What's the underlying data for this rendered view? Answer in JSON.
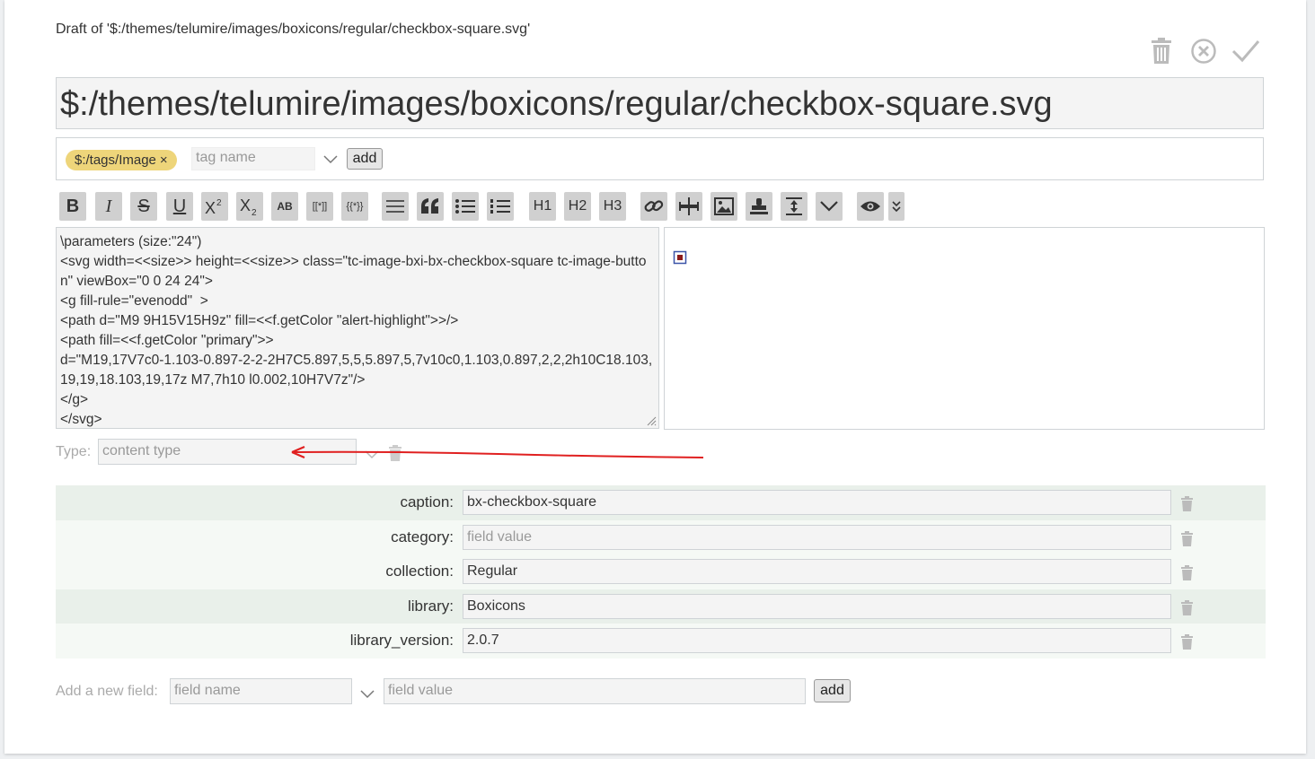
{
  "draft_title": "Draft of '$:/themes/telumire/images/boxicons/regular/checkbox-square.svg'",
  "title_value": "$:/themes/telumire/images/boxicons/regular/checkbox-square.svg",
  "controls": {
    "delete": "trash-icon",
    "cancel": "cancel-icon",
    "done": "check-icon"
  },
  "tags": {
    "items": [
      {
        "label": "$:/tags/Image",
        "remove": "×"
      }
    ],
    "placeholder": "tag name",
    "add_label": "add"
  },
  "toolbar": {
    "bold": "B",
    "italic": "I",
    "strike": "S",
    "underline": "U",
    "h1": "H1",
    "h2": "H2",
    "h3": "H3",
    "smallcaps": "AB",
    "wikilink": "[[*]]",
    "transclude": "{{*}}"
  },
  "editor_text": "\\parameters (size:\"24\")\n<svg width=<<size>> height=<<size>> class=\"tc-image-bxi-bx-checkbox-square tc-image-button\" viewBox=\"0 0 24 24\">\n<g fill-rule=\"evenodd\"  >\n<path d=\"M9 9H15V15H9z\" fill=<<f.getColor \"alert-highlight\">>/>\n<path fill=<<f.getColor \"primary\">>\nd=\"M19,17V7c0-1.103-0.897-2-2-2H7C5.897,5,5,5.897,5,7v10c0,1.103,0.897,2,2,2h10C18.103,19,19,18.103,19,17z M7,7h10 l0.002,10H7V7z\"/>\n</g>\n</svg>",
  "type": {
    "label": "Type:",
    "placeholder": "content type"
  },
  "fields": [
    {
      "name": "caption:",
      "value": "bx-checkbox-square",
      "placeholder": false
    },
    {
      "name": "category:",
      "value": "field value",
      "placeholder": true
    },
    {
      "name": "collection:",
      "value": "Regular",
      "placeholder": false
    },
    {
      "name": "library:",
      "value": "Boxicons",
      "placeholder": false
    },
    {
      "name": "library_version:",
      "value": "2.0.7",
      "placeholder": false
    }
  ],
  "new_field": {
    "label": "Add a new field:",
    "name_placeholder": "field name",
    "value_placeholder": "field value",
    "add_label": "add"
  },
  "colors": {
    "tag_pill": "#eed57a",
    "arrow": "#e02020",
    "preview_fill": "#8b1a1a",
    "preview_stroke": "#3b54a8"
  }
}
